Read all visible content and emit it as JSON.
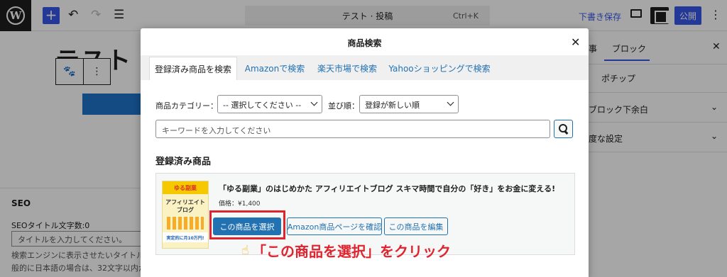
{
  "topbar": {
    "command_text": "テスト · 投稿",
    "shortcut": "Ctrl+K",
    "save_draft": "下書き保存",
    "publish": "公開"
  },
  "editor": {
    "post_title": "テスト"
  },
  "sidebar": {
    "tab_post_fragment": "事",
    "tab_block": "ブロック",
    "pochip": "ポチップ",
    "row_margin": "ブロック下余白",
    "row_advanced": "度な設定"
  },
  "seo": {
    "title": "SEO",
    "title_count_label": "SEOタイトル文字数:0",
    "title_placeholder": "タイトルを入力してください。",
    "help_line1": "検索エンジンに表示させたいタイトル...",
    "help_line2": "般的に日本語の場合は、32文字以内が..."
  },
  "modal": {
    "title": "商品検索",
    "close_glyph": "✕",
    "tabs": [
      {
        "label": "登録済み商品を検索",
        "active": true
      },
      {
        "label": "Amazonで検索",
        "active": false
      },
      {
        "label": "楽天市場で検索",
        "active": false
      },
      {
        "label": "Yahooショッピングで検索",
        "active": false
      }
    ],
    "category_label": "商品カテゴリー：",
    "category_value": "-- 選択してください --",
    "sort_label": "並び順：",
    "sort_value": "登録が新しい順",
    "keyword_placeholder": "キーワードを入力してください",
    "section_title": "登録済み商品",
    "product": {
      "title": "「ゆる副業」のはじめかた アフィリエイトブログ スキマ時間で自分の「好き」をお金に変える!",
      "price": "価格：¥1,400",
      "cover_top": "ゆる副業",
      "cover_main": "アフィリエイトブログ",
      "cover_bottom": "実定的に月10万円!"
    },
    "buttons": {
      "select": "この商品を選択",
      "amazon_page": "Amazon商品ページを確認",
      "edit": "この商品を編集"
    }
  },
  "annotation": {
    "text": "「この商品を選択」をクリック",
    "highlight_color": "#e0242f"
  }
}
